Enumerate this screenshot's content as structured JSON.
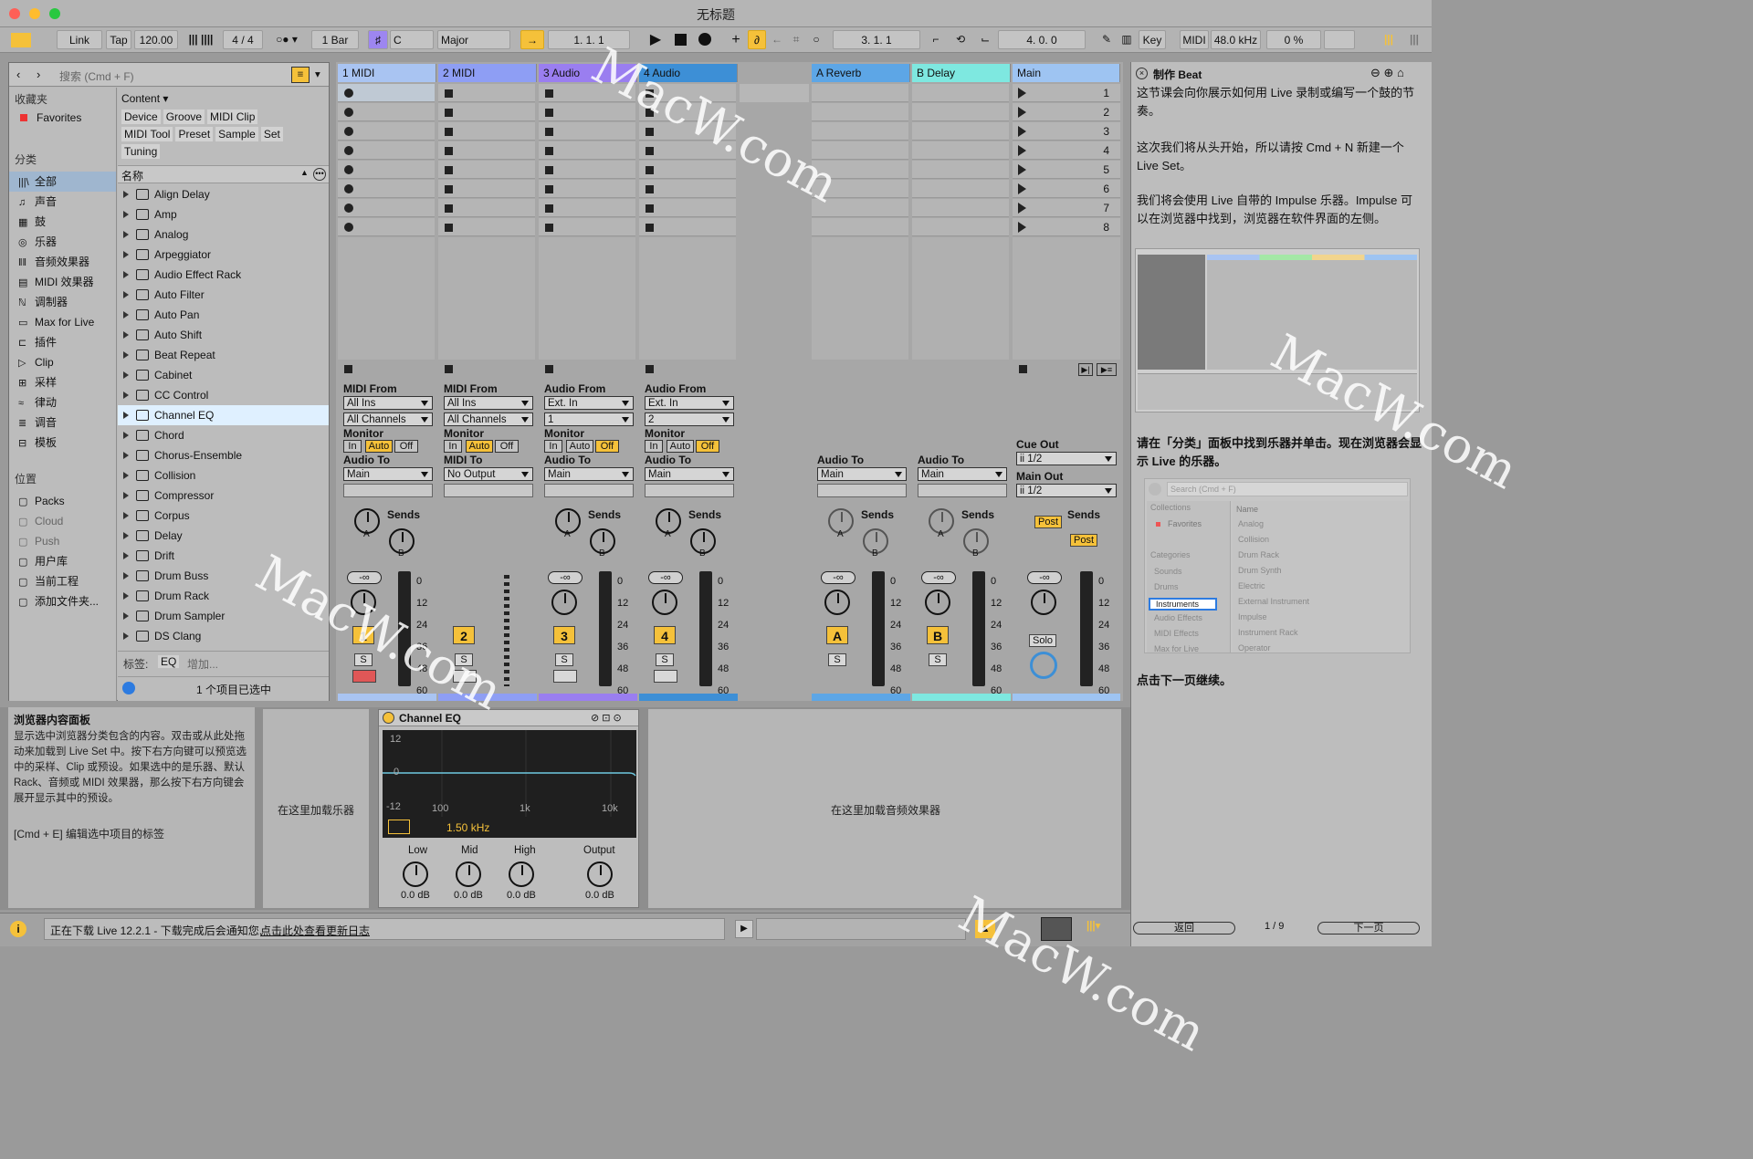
{
  "window": {
    "title": "无标题"
  },
  "controlbar": {
    "link": "Link",
    "tap": "Tap",
    "tempo": "120.00",
    "signature_num": "4",
    "signature_den": "4",
    "quantize": "1 Bar",
    "key_root": "C",
    "scale": "Major",
    "position": "1.   1.   1",
    "loop_start": "3.   1.   1",
    "loop_length": "4.   0.   0",
    "key_label": "Key",
    "midi_label": "MIDI",
    "sample_rate": "48.0 kHz",
    "cpu": "0 %"
  },
  "browser": {
    "search_placeholder": "搜索 (Cmd + F)",
    "collections_header": "收藏夹",
    "favorites": "Favorites",
    "categories_header": "分类",
    "categories": [
      "全部",
      "声音",
      "鼓",
      "乐器",
      "音频效果器",
      "MIDI 效果器",
      "调制器",
      "Max for Live",
      "插件",
      "Clip",
      "采样",
      "律动",
      "调音",
      "模板"
    ],
    "places_header": "位置",
    "places": [
      "Packs",
      "Cloud",
      "Push",
      "用户库",
      "当前工程",
      "添加文件夹..."
    ],
    "content_dropdown": "Content",
    "filter_tags": [
      "Device",
      "Groove",
      "MIDI Clip",
      "MIDI Tool",
      "Preset",
      "Sample",
      "Set",
      "Tuning"
    ],
    "name_header": "名称",
    "items": [
      "Align Delay",
      "Amp",
      "Analog",
      "Arpeggiator",
      "Audio Effect Rack",
      "Auto Filter",
      "Auto Pan",
      "Auto Shift",
      "Beat Repeat",
      "Cabinet",
      "CC Control",
      "Channel EQ",
      "Chord",
      "Chorus-Ensemble",
      "Collision",
      "Compressor",
      "Corpus",
      "Delay",
      "Drift",
      "Drum Buss",
      "Drum Rack",
      "Drum Sampler",
      "DS Clang"
    ],
    "selected_item": "Channel EQ",
    "tags_label": "标签:",
    "tag_value": "EQ",
    "tag_add": "增加...",
    "selection_status": "1 个项目已选中"
  },
  "session": {
    "tracks": [
      {
        "name": "1 MIDI",
        "color": "#a9c4f2",
        "input_label": "MIDI From",
        "input": "All Ins",
        "channel": "All Channels",
        "monitor": [
          "In",
          "Auto",
          "Off"
        ],
        "output_label": "Audio To",
        "output": "Main",
        "number": "1"
      },
      {
        "name": "2 MIDI",
        "color": "#8e9ef4",
        "input_label": "MIDI From",
        "input": "All Ins",
        "channel": "All Channels",
        "monitor": [
          "In",
          "Auto",
          "Off"
        ],
        "output_label": "MIDI To",
        "output": "No Output",
        "number": "2"
      },
      {
        "name": "3 Audio",
        "color": "#9a7ef0",
        "input_label": "Audio From",
        "input": "Ext. In",
        "channel": "1",
        "monitor": [
          "In",
          "Auto",
          "Off"
        ],
        "output_label": "Audio To",
        "output": "Main",
        "number": "3"
      },
      {
        "name": "4 Audio",
        "color": "#3d8fd6",
        "input_label": "Audio From",
        "input": "Ext. In",
        "channel": "2",
        "monitor": [
          "In",
          "Auto",
          "Off"
        ],
        "output_label": "Audio To",
        "output": "Main",
        "number": "4"
      }
    ],
    "returns": [
      {
        "name": "A Reverb",
        "color": "#5da6e6",
        "output_label": "Audio To",
        "output": "Main",
        "letter": "A"
      },
      {
        "name": "B Delay",
        "color": "#7ee8e0",
        "output_label": "Audio To",
        "output": "Main",
        "letter": "B"
      }
    ],
    "main": {
      "name": "Main",
      "color": "#9ec4f2",
      "scenes": [
        "1",
        "2",
        "3",
        "4",
        "5",
        "6",
        "7",
        "8"
      ],
      "cue_out_label": "Cue Out",
      "cue_out": "ii 1/2",
      "main_out_label": "Main Out",
      "main_out": "ii 1/2",
      "post": "Post",
      "solo": "Solo"
    },
    "sends_label": "Sends",
    "send_a": "A",
    "send_b": "B",
    "volume": "-∞",
    "solo": "S",
    "meter_scale": [
      "0",
      "12",
      "24",
      "36",
      "48",
      "60"
    ]
  },
  "devices": {
    "info_title": "浏览器内容面板",
    "info_body": "显示选中浏览器分类包含的内容。双击或从此处拖动来加载到 Live Set 中。按下右方向键可以预览选中的采样、Clip 或预设。如果选中的是乐器、默认 Rack、音频或 MIDI 效果器，那么按下右方向键会展开显示其中的预设。",
    "info_shortcut": "[Cmd + E] 编辑选中项目的标签",
    "drop_instrument": "在这里加载乐器",
    "drop_effects": "在这里加载音频效果器",
    "eq": {
      "name": "Channel EQ",
      "db_ticks": [
        "12",
        "0",
        "-12"
      ],
      "freq_ticks": [
        "100",
        "1k",
        "10k"
      ],
      "freq_value": "1.50 kHz",
      "knobs": [
        {
          "label": "Low",
          "value": "0.0 dB"
        },
        {
          "label": "Mid",
          "value": "0.0 dB"
        },
        {
          "label": "High",
          "value": "0.0 dB"
        },
        {
          "label": "Output",
          "value": "0.0 dB"
        }
      ]
    }
  },
  "status": {
    "message": "正在下载 Live 12.2.1 - 下载完成后会通知您.",
    "link": "点击此处查看更新日志"
  },
  "help": {
    "title": "制作 Beat",
    "p1": "这节课会向你展示如何用 Live 录制或编写一个鼓的节奏。",
    "p2": "这次我们将从头开始，所以请按 Cmd + N 新建一个 Live Set。",
    "p3": "我们将会使用 Live 自带的 Impulse 乐器。Impulse 可以在浏览器中找到，浏览器在软件界面的左侧。",
    "p4": "请在「分类」面板中找到乐器并单击。现在浏览器会显示 Live 的乐器。",
    "p5": "点击下一页继续。",
    "mini_search": "Search (Cmd + F)",
    "mini_collections": "Collections",
    "mini_favorites": "Favorites",
    "mini_categories": "Categories",
    "mini_cats": [
      "Sounds",
      "Drums",
      "Instruments",
      "Audio Effects",
      "MIDI Effects",
      "Max for Live"
    ],
    "mini_name": "Name",
    "mini_items": [
      "Analog",
      "Collision",
      "Drum Rack",
      "Drum Synth",
      "Electric",
      "External Instrument",
      "Impulse",
      "Instrument Rack",
      "Operator"
    ],
    "back": "返回",
    "page": "1 / 9",
    "next": "下一页"
  },
  "watermark": "MacW.com"
}
